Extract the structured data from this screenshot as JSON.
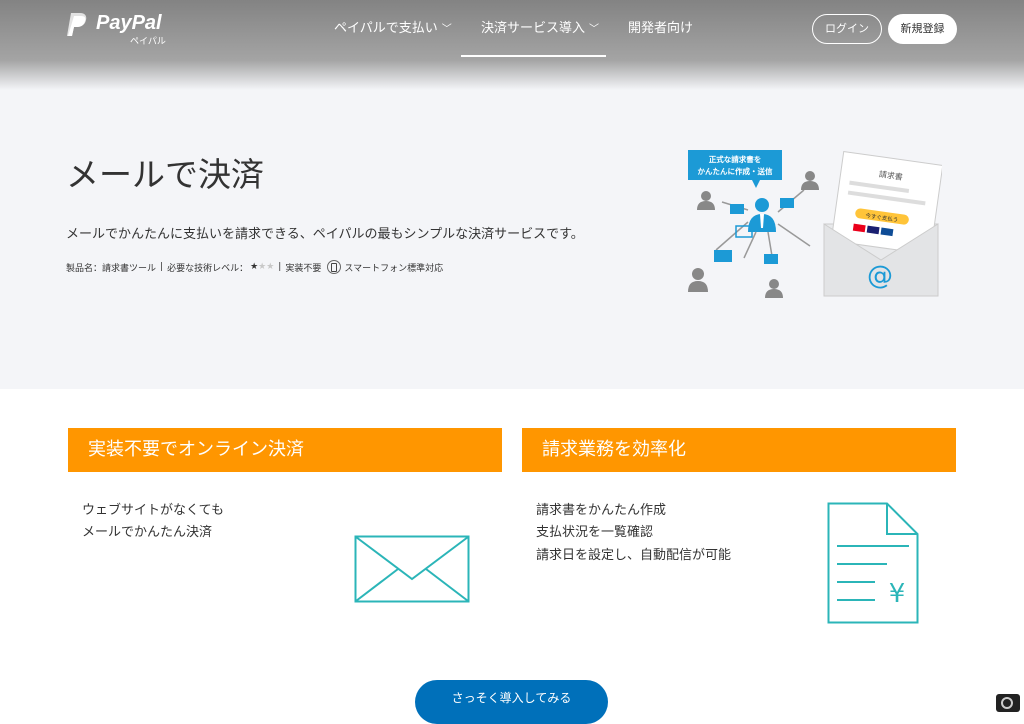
{
  "header": {
    "logo_text": "PayPal",
    "logo_sub": "ペイパル",
    "nav": [
      {
        "label": "ペイパルで支払い",
        "chevron": "﹀"
      },
      {
        "label": "決済サービス導入",
        "chevron": "﹀"
      },
      {
        "label": "開発者向け",
        "chevron": ""
      }
    ],
    "login_label": "ログイン",
    "signup_label": "新規登録"
  },
  "hero": {
    "title": "メールで決済",
    "description": "メールでかんたんに支払いを請求できる、ペイパルの最もシンプルな決済サービスです。",
    "meta_product": "製品名：請求書ツール",
    "meta_skill": "必要な技術レベル：",
    "skill_stars": "★",
    "skill_stars_off": "★★",
    "meta_impl": "実装不要",
    "meta_smartphone": "スマートフォン標準対応",
    "illus_bubble_1": "正式な請求書を",
    "illus_bubble_2": "かんたんに作成・送信",
    "illus_invoice_title": "請求書",
    "illus_pay_button": "今すぐ支払う",
    "illus_at": "@"
  },
  "cards": [
    {
      "title": "実装不要でオンライン決済",
      "lines": [
        "ウェブサイトがなくても",
        "メールでかんたん決済"
      ],
      "icon": "envelope-icon"
    },
    {
      "title": "請求業務を効率化",
      "lines": [
        "請求書をかんたん作成",
        "支払状況を一覧確認",
        "請求日を設定し、自動配信が可能"
      ],
      "icon": "invoice-document-icon",
      "icon_glyph": "¥"
    }
  ],
  "cta_label": "さっそく導入してみる",
  "colors": {
    "accent_orange": "#ff9600",
    "line_teal": "#2bb5b8",
    "cta_blue": "#0070ba",
    "illus_blue": "#1c9ad6"
  }
}
